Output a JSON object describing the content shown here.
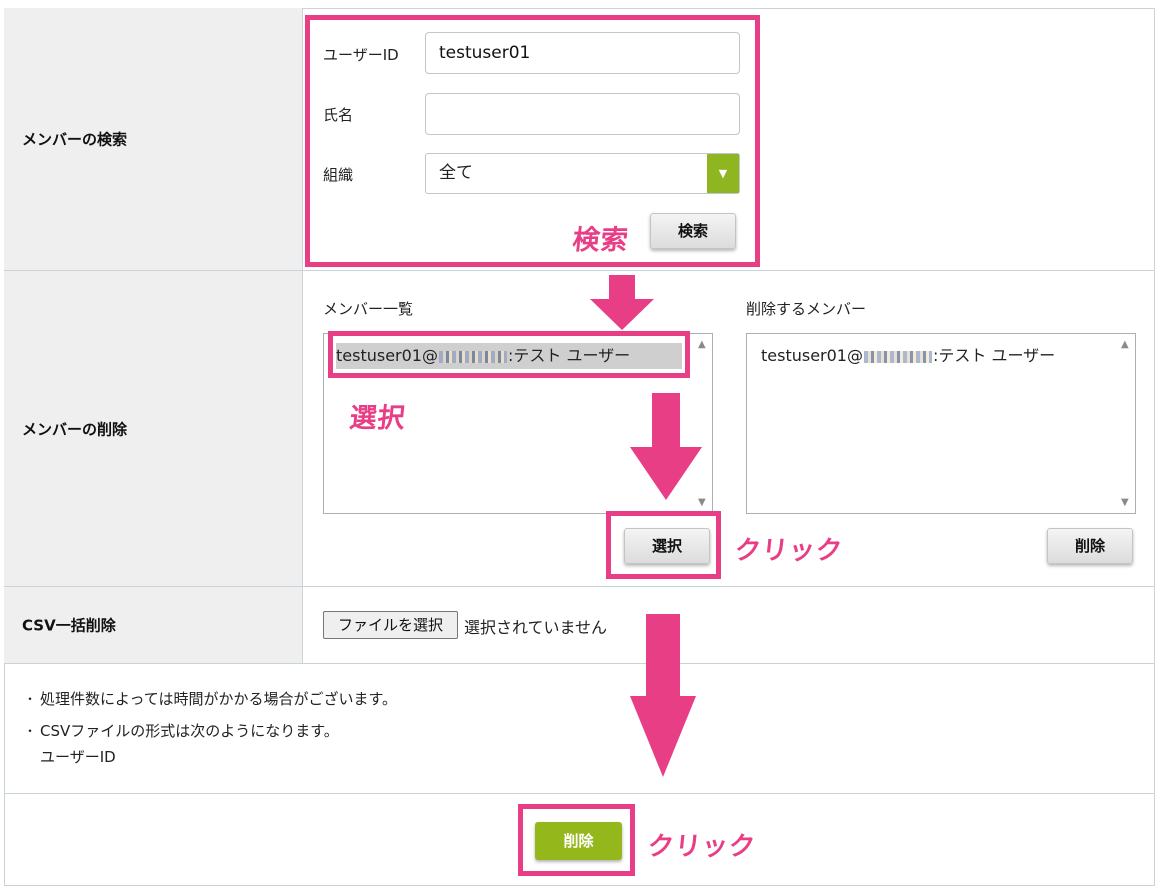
{
  "search_section": {
    "label": "メンバーの検索",
    "user_id_label": "ユーザーID",
    "user_id_value": "testuser01",
    "name_label": "氏名",
    "name_value": "",
    "org_label": "組織",
    "org_selected": "全て",
    "search_button": "検索"
  },
  "delete_section": {
    "label": "メンバーの削除",
    "member_list_label": "メンバー一覧",
    "member_list_items": [
      {
        "prefix": "testuser01@",
        "suffix": ":テスト ユーザー",
        "selected": true
      }
    ],
    "to_delete_label": "削除するメンバー",
    "to_delete_items": [
      {
        "prefix": "testuser01@",
        "suffix": ":テスト ユーザー"
      }
    ],
    "select_button": "選択",
    "delete_list_button": "削除"
  },
  "csv_section": {
    "label": "CSV一括削除",
    "file_button": "ファイルを選択",
    "file_status": "選択されていません"
  },
  "notes": {
    "bullet": "・",
    "line1": "処理件数によっては時間がかかる場合がございます。",
    "line2": "CSVファイルの形式は次のようになります。",
    "line3": "ユーザーID"
  },
  "footer": {
    "delete_button": "削除"
  },
  "annotations": {
    "search": "検索",
    "select": "選択",
    "click1": "クリック",
    "click2": "クリック"
  },
  "colors": {
    "highlight": "#e83e86",
    "accent_green": "#94b81b",
    "label_bg": "#efefef"
  },
  "icons": {
    "select_arrow": "chevron-down-icon",
    "scroll_up": "scroll-up-icon",
    "scroll_down": "scroll-down-icon"
  }
}
